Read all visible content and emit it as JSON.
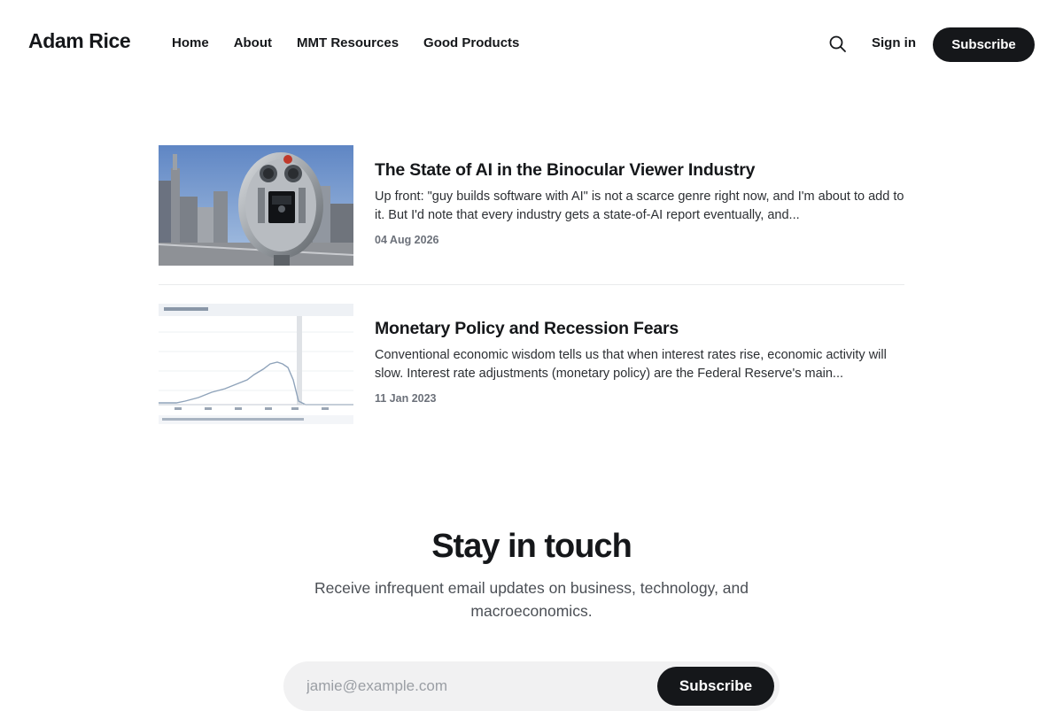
{
  "site": {
    "title": "Adam Rice"
  },
  "nav": {
    "items": [
      {
        "label": "Home"
      },
      {
        "label": "About"
      },
      {
        "label": "MMT Resources"
      },
      {
        "label": "Good Products"
      }
    ],
    "search_icon": "search-icon",
    "signin_label": "Sign in",
    "subscribe_label": "Subscribe"
  },
  "posts": [
    {
      "title": "The State of AI in the Binocular Viewer Industry",
      "excerpt": "Up front: \"guy builds software with AI\" is not a scarce genre right now, and I'm about to add to it. But I'd note that every industry gets a state-of-AI report eventually, and...",
      "date": "04 Aug 2026",
      "thumbnail": "binocular-viewer-photo"
    },
    {
      "title": "Monetary Policy and Recession Fears",
      "excerpt": "Conventional economic wisdom tells us that when interest rates rise, economic activity will slow. Interest rate adjustments (monetary policy) are the Federal Reserve's main...",
      "date": "11 Jan 2023",
      "thumbnail": "federal-funds-rate-chart"
    }
  ],
  "cta": {
    "title": "Stay in touch",
    "subtitle": "Receive infrequent email updates on business, technology, and macroeconomics.",
    "email_placeholder": "jamie@example.com",
    "button_label": "Subscribe"
  },
  "colors": {
    "primary": "#15171a",
    "muted": "#6c717a",
    "input_bg": "#f1f1f2"
  }
}
